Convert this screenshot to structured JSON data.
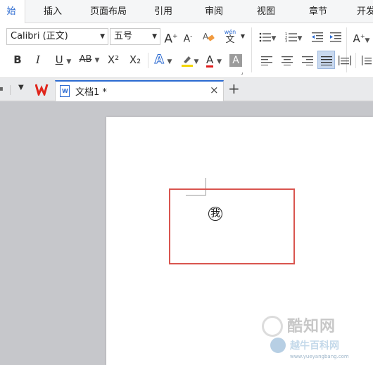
{
  "menu": {
    "tabs": [
      "始",
      "插入",
      "页面布局",
      "引用",
      "审阅",
      "视图",
      "章节",
      "开发"
    ]
  },
  "ribbon": {
    "font_name": "Calibri (正文)",
    "font_size": "五号",
    "bold": "B",
    "italic": "I",
    "underline": "U",
    "strikethrough": "AB",
    "superscript": "X²",
    "subscript": "X₂",
    "phonetic_top": "wén",
    "phonetic_bottom": "文",
    "grow_font": "A",
    "shrink_font": "A",
    "font_color_letter": "A",
    "char_shading_letter": "A",
    "text_effect_letter": "A",
    "text_size_letter": "A"
  },
  "docbar": {
    "doc_title": "文档1 *",
    "close": "×",
    "new_tab": "+"
  },
  "document": {
    "enclosed_char": "我"
  },
  "watermark": {
    "brand": "酷知网",
    "secondary": "越牛百科网",
    "url": "www.yueyangbang.com"
  },
  "colors": {
    "accent": "#2b6ad1",
    "box_border": "#d9554f",
    "wps_logo": "#e0251b",
    "highlight": "#f4d600",
    "font_color_bar": "#e01b1b"
  }
}
